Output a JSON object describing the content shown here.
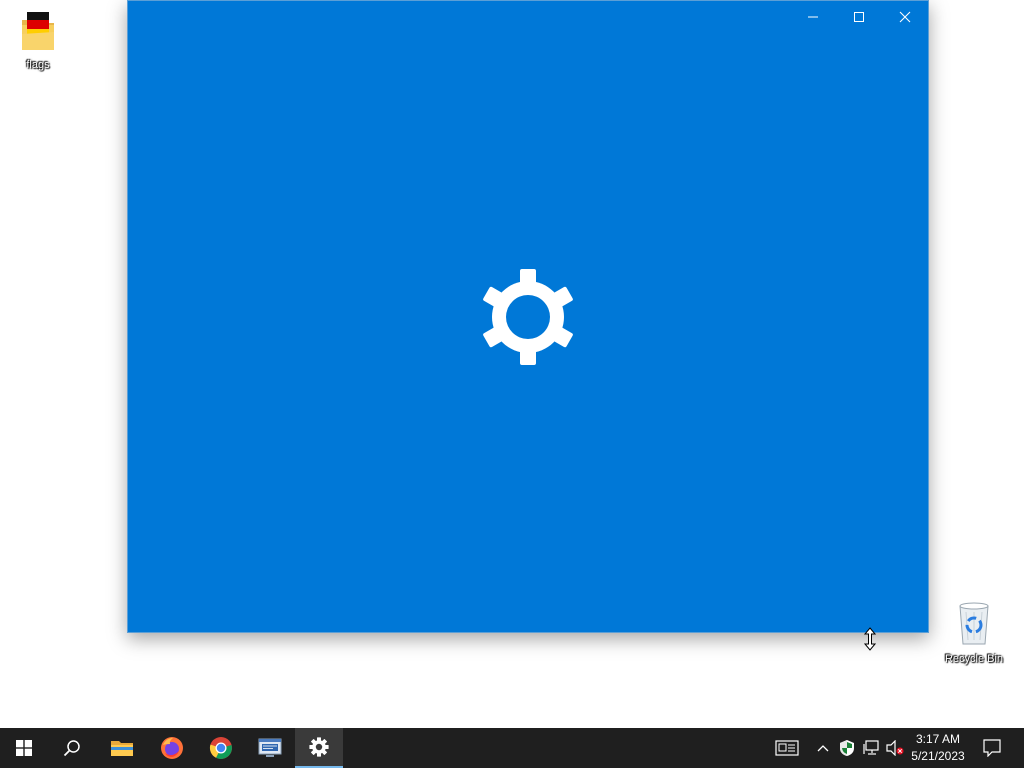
{
  "desktop": {
    "icons": [
      {
        "label": "flags",
        "icon": "folder-flag-germany-icon"
      },
      {
        "label": "Recycle Bin",
        "icon": "recycle-bin-icon"
      }
    ]
  },
  "window": {
    "app": "Settings",
    "background_color": "#0078d7",
    "splash_icon": "gear-icon",
    "caption_buttons": [
      "minimize-icon",
      "maximize-icon",
      "close-icon"
    ]
  },
  "taskbar": {
    "pinned": [
      {
        "name": "start",
        "icon": "windows-logo-icon"
      },
      {
        "name": "search",
        "icon": "search-icon"
      },
      {
        "name": "file-explorer",
        "icon": "folder-icon"
      },
      {
        "name": "firefox",
        "icon": "firefox-icon"
      },
      {
        "name": "chrome",
        "icon": "chrome-icon"
      },
      {
        "name": "network-connections",
        "icon": "network-window-icon"
      },
      {
        "name": "settings",
        "icon": "gear-icon",
        "active": true
      }
    ],
    "tray": [
      "news-icon",
      "chevron-up-icon",
      "security-shield-icon",
      "network-icon",
      "volume-muted-icon"
    ],
    "clock": {
      "time": "3:17 AM",
      "date": "5/21/2023"
    },
    "notifications_icon": "action-center-icon"
  }
}
